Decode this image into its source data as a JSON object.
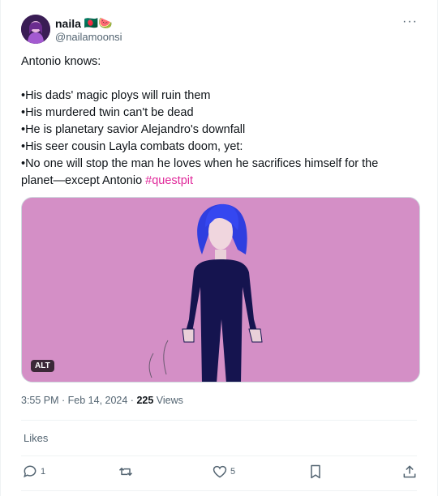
{
  "author": {
    "name": "naila",
    "emojis": "🇧🇩🍉",
    "handle": "@nailamoonsi"
  },
  "more_label": "···",
  "post": {
    "text": "Antonio knows:\n\n•His dads' magic ploys will ruin them\n•His murdered twin can't be dead\n•He is planetary savior Alejandro's downfall\n•His seer cousin Layla combats doom, yet:\n•No one will stop the man he loves when he sacrifices himself for the planet—except Antonio ",
    "hashtag": "#questpit"
  },
  "media": {
    "alt_badge": "ALT"
  },
  "meta": {
    "timestamp": "3:55 PM · Feb 14, 2024 · ",
    "views_count": "225",
    "views_label": " Views"
  },
  "likes_label": "Likes",
  "actions": {
    "reply_count": "1",
    "like_count": "5"
  },
  "colors": {
    "hashtag": "#e0289a",
    "media_bg": "#d48fc6"
  }
}
